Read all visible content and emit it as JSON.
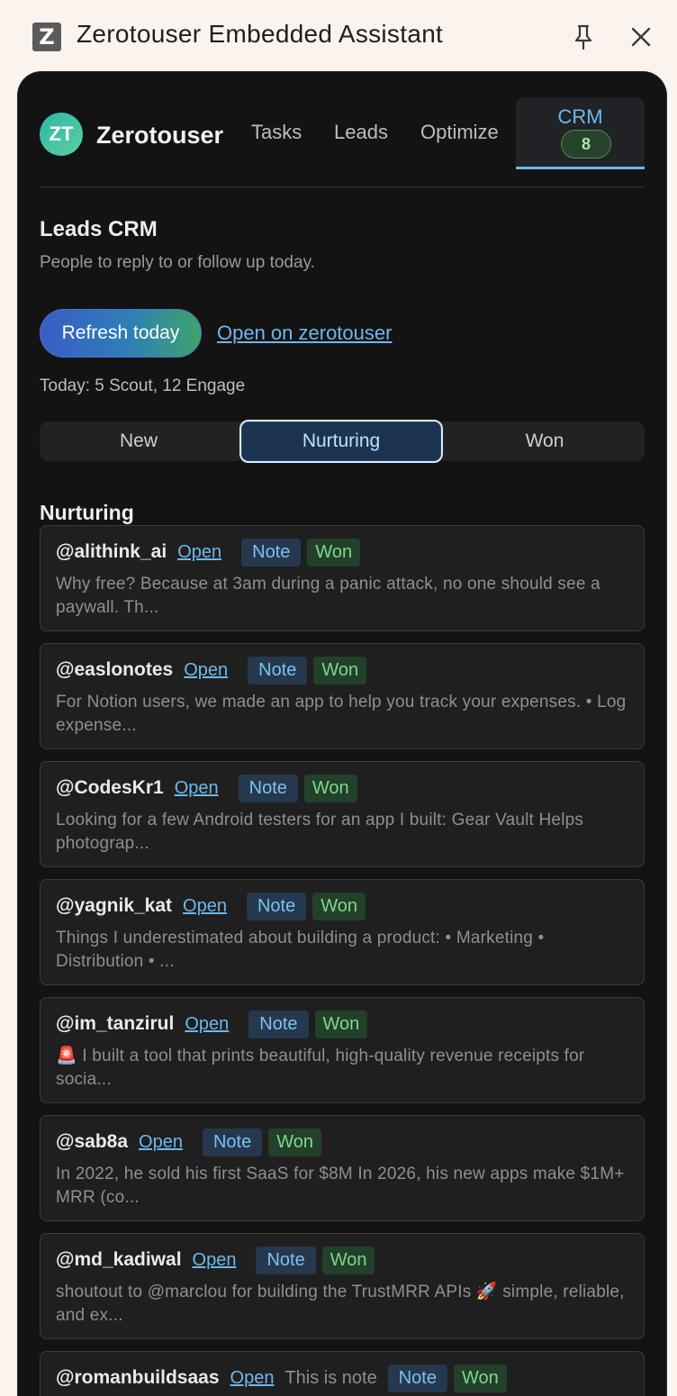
{
  "window": {
    "app_icon_letter": "Z",
    "title": "Zerotouser Embedded Assistant",
    "pin_icon": "pin-icon",
    "close_icon": "close-icon"
  },
  "nav": {
    "avatar_initials": "ZT",
    "brand": "Zerotouser",
    "tabs": [
      "Tasks",
      "Leads",
      "Optimize"
    ],
    "active_tab": "CRM",
    "active_count": "8"
  },
  "header": {
    "title": "Leads CRM",
    "subtitle": "People to reply to or follow up today.",
    "refresh_label": "Refresh today",
    "open_link": "Open on zerotouser",
    "today_text": "Today: 5 Scout, 12 Engage"
  },
  "segments": {
    "items": [
      "New",
      "Nurturing",
      "Won"
    ],
    "selected": "Nurturing"
  },
  "list": {
    "title": "Nurturing",
    "open_label": "Open",
    "note_label": "Note",
    "won_label": "Won",
    "leads": [
      {
        "handle": "@alithink_ai",
        "snippet": "Why free? Because at 3am during a panic attack, no one should see a paywall. Th..."
      },
      {
        "handle": "@easlonotes",
        "snippet": "For Notion users, we made an app to help you track your expenses. • Log expense..."
      },
      {
        "handle": "@CodesKr1",
        "snippet": "Looking for a few Android testers for an app I built: Gear Vault Helps photograp..."
      },
      {
        "handle": "@yagnik_kat",
        "snippet": "Things I underestimated about building a product: • Marketing • Distribution • ..."
      },
      {
        "handle": "@im_tanzirul",
        "snippet": "🚨 I built a tool that prints beautiful, high-quality revenue receipts for socia..."
      },
      {
        "handle": "@sab8a",
        "snippet": "In 2022, he sold his first SaaS for $8M In 2026, his new apps make $1M+ MRR (co..."
      },
      {
        "handle": "@md_kadiwal",
        "snippet": "shoutout to @marclou for building the TrustMRR APIs 🚀 simple, reliable, and ex..."
      },
      {
        "handle": "@romanbuildsaas",
        "note_text": "This is note",
        "snippet": ""
      }
    ]
  }
}
